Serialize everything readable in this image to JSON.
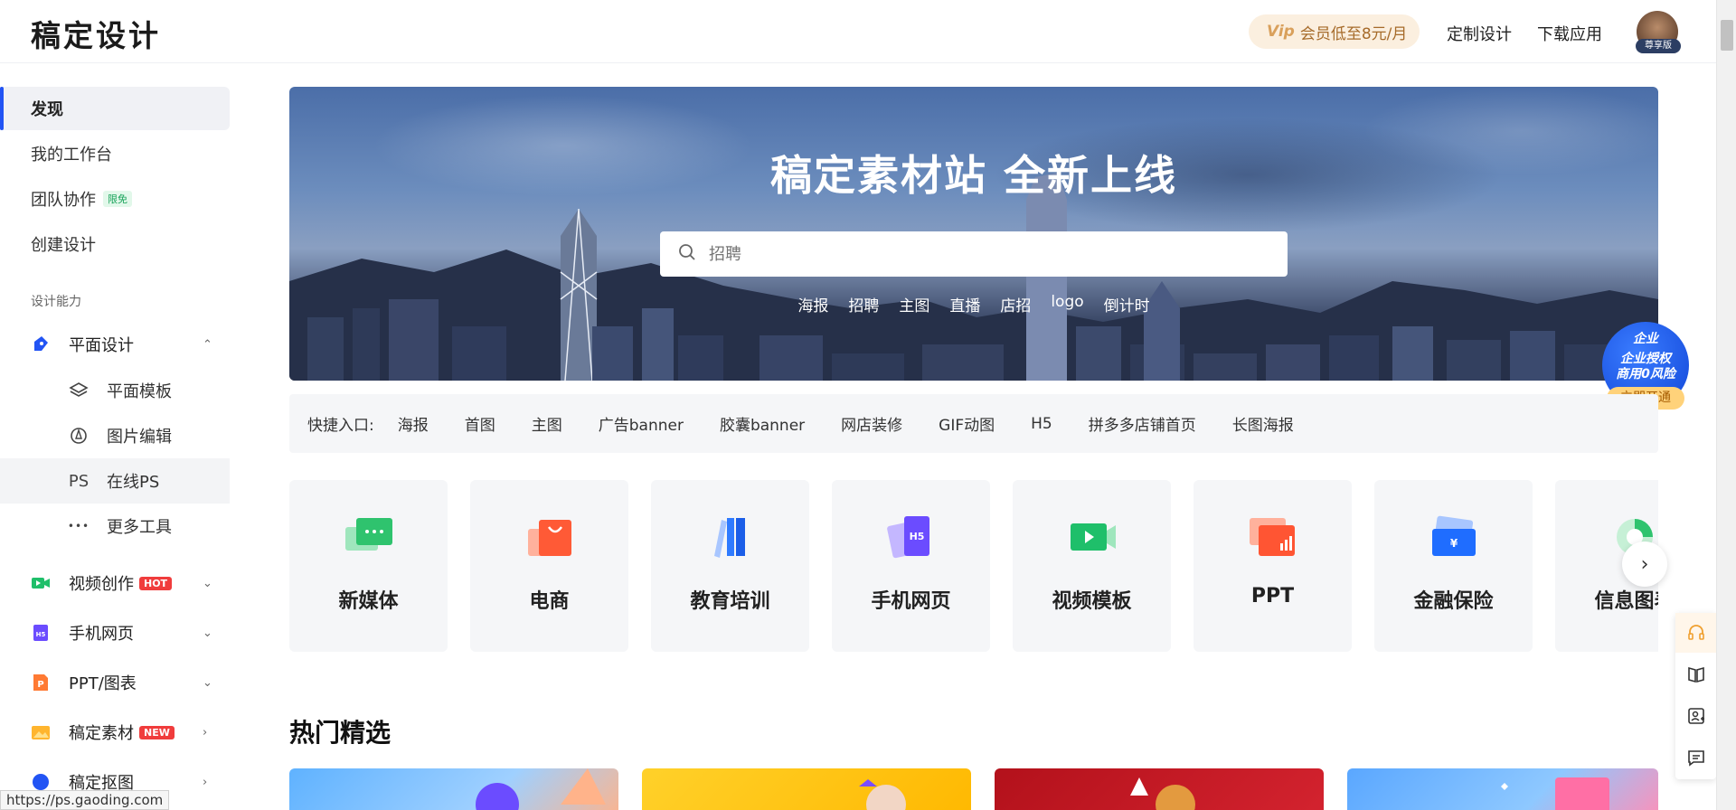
{
  "header": {
    "logo": "稿定设计",
    "vip_label": "会员低至8元/月",
    "vip_mark": "Vip",
    "links": [
      "定制设计",
      "下载应用"
    ],
    "avatar_badge": "尊享版"
  },
  "sidebar": {
    "primary": [
      {
        "label": "发现",
        "active": true
      },
      {
        "label": "我的工作台"
      },
      {
        "label": "团队协作",
        "badge": "限免"
      },
      {
        "label": "创建设计"
      }
    ],
    "section_label": "设计能力",
    "categories": [
      {
        "label": "平面设计",
        "icon": "pen-icon",
        "expanded": true
      },
      {
        "label": "视频创作",
        "icon": "video-icon",
        "badge": "HOT"
      },
      {
        "label": "手机网页",
        "icon": "h5-icon"
      },
      {
        "label": "PPT/图表",
        "icon": "ppt-icon"
      },
      {
        "label": "稿定素材",
        "icon": "image-icon",
        "badge": "NEW"
      },
      {
        "label": "稿定抠图",
        "icon": "cutout-icon"
      }
    ],
    "sub_items": [
      {
        "label": "平面模板",
        "icon": "layers-icon"
      },
      {
        "label": "图片编辑",
        "icon": "brush-icon"
      },
      {
        "label": "在线PS",
        "icon": "ps-icon",
        "glyph": "PS",
        "selected": true
      },
      {
        "label": "更多工具",
        "icon": "more-icon",
        "glyph": "•••"
      }
    ]
  },
  "banner": {
    "title": "稿定素材站 全新上线",
    "search_placeholder": "招聘",
    "hot_words": [
      "海报",
      "招聘",
      "主图",
      "直播",
      "店招",
      "logo",
      "倒计时"
    ]
  },
  "quick_entry": {
    "label": "快捷入口:",
    "items": [
      "海报",
      "首图",
      "主图",
      "广告banner",
      "胶囊banner",
      "网店装修",
      "GIF动图",
      "H5",
      "拼多多店铺首页",
      "长图海报"
    ]
  },
  "categories": [
    {
      "label": "新媒体",
      "icon": "chat-icon",
      "color": "#2fc36e"
    },
    {
      "label": "电商",
      "icon": "bag-icon",
      "color": "#ff5a36"
    },
    {
      "label": "教育培训",
      "icon": "books-icon",
      "color": "#2f7bff"
    },
    {
      "label": "手机网页",
      "icon": "h5-card-icon",
      "color": "#6b4cff"
    },
    {
      "label": "视频模板",
      "icon": "video-card-icon",
      "color": "#1fbf6a"
    },
    {
      "label": "PPT",
      "icon": "ppt-card-icon",
      "color": "#ff5533"
    },
    {
      "label": "金融保险",
      "icon": "wallet-icon",
      "color": "#1f6dff"
    },
    {
      "label": "信息图表",
      "icon": "pie-chart-icon",
      "color": "#2fc36e"
    }
  ],
  "enterprise": {
    "line1": "企业",
    "line2": "企业授权",
    "line3": "商用0风险",
    "button": "立即开通"
  },
  "hot_section": {
    "title": "热门精选"
  },
  "status_url": "https://ps.gaoding.com",
  "colors": {
    "accent": "#2254f4",
    "hot_badge": "#f03c3c",
    "free_badge": "#19a35a"
  }
}
